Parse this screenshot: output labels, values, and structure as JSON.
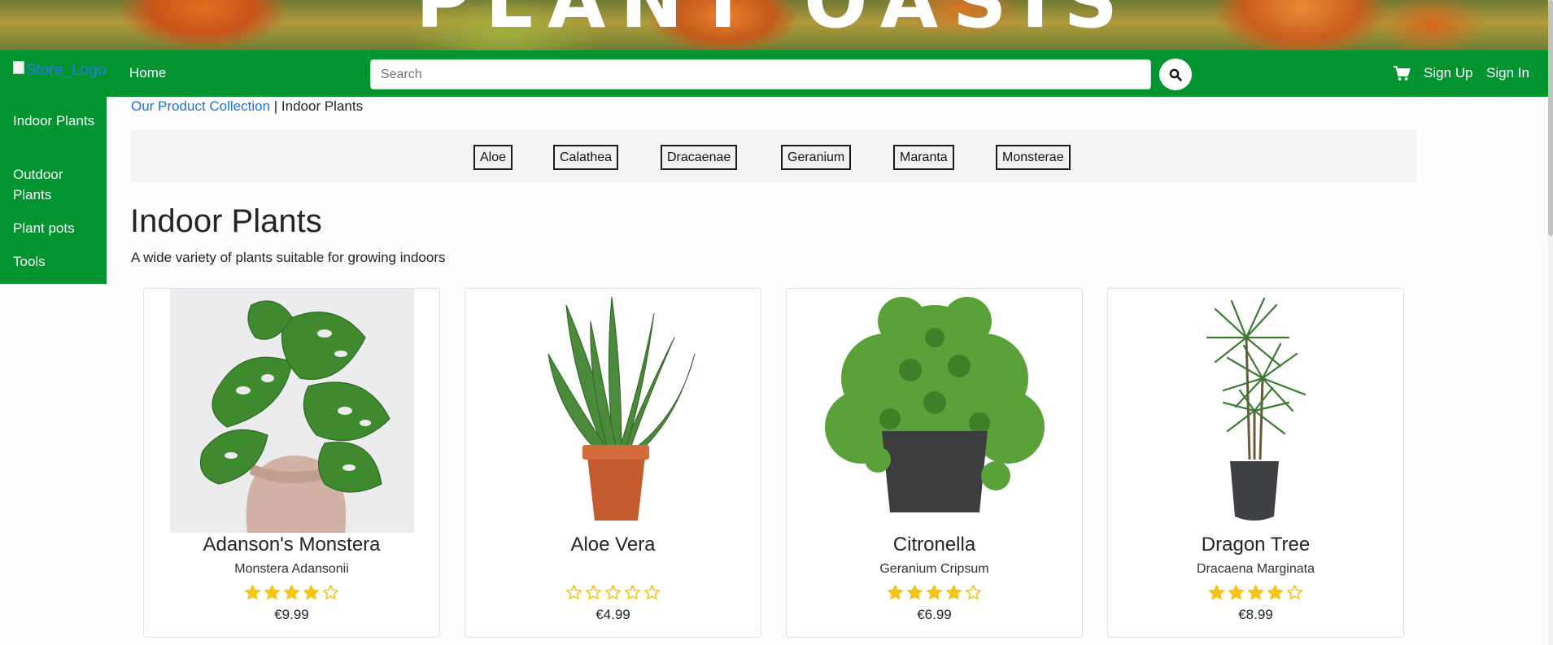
{
  "banner": {
    "title": "PLANT OASIS"
  },
  "navbar": {
    "logo_alt": "Store_Logo",
    "home": "Home",
    "search_placeholder": "Search",
    "signup": "Sign Up",
    "signin": "Sign In",
    "icons": {
      "search": "search-icon",
      "cart": "cart-icon"
    },
    "background": "#039432"
  },
  "sidebar": {
    "items": [
      {
        "label": "Indoor Plants"
      },
      {
        "label": "Outdoor Plants"
      },
      {
        "label": "Plant pots"
      },
      {
        "label": "Tools"
      }
    ]
  },
  "breadcrumb": {
    "parent": "Our Product Collection",
    "separator": " | ",
    "current": "Indoor Plants"
  },
  "filters": [
    "Aloe",
    "Calathea",
    "Dracaenae",
    "Geranium",
    "Maranta",
    "Monsterae"
  ],
  "page": {
    "title": "Indoor Plants",
    "subtitle": "A wide variety of plants suitable for growing indoors"
  },
  "products": [
    {
      "name": "Adanson's Monstera",
      "species": "Monstera Adansonii",
      "rating": 4,
      "max_rating": 5,
      "price": "€9.99"
    },
    {
      "name": "Aloe Vera",
      "species": "",
      "rating": 0,
      "max_rating": 5,
      "price": "€4.99"
    },
    {
      "name": "Citronella",
      "species": "Geranium Cripsum",
      "rating": 4,
      "max_rating": 5,
      "price": "€6.99"
    },
    {
      "name": "Dragon Tree",
      "species": "Dracaena Marginata",
      "rating": 4,
      "max_rating": 5,
      "price": "€8.99"
    }
  ],
  "colors": {
    "star": "#f5c518",
    "link": "#1a73e8",
    "accent": "#039432"
  }
}
